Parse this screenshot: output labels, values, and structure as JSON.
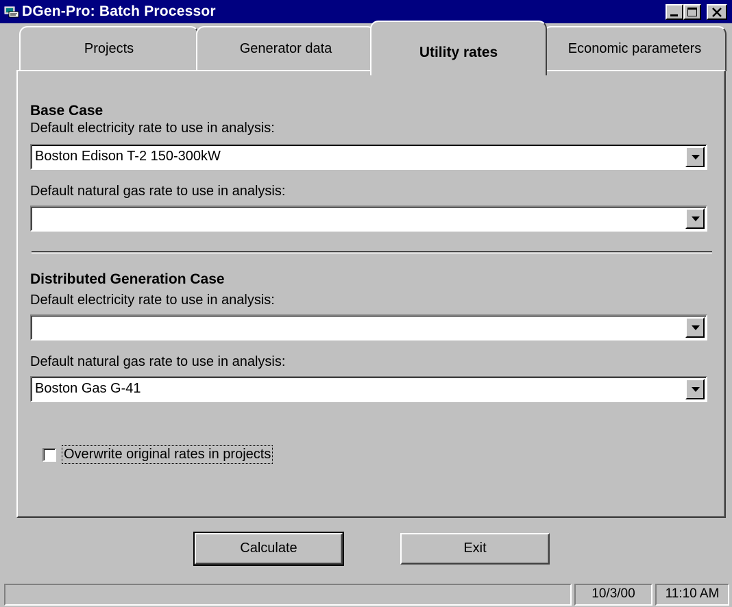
{
  "window": {
    "title": "DGen-Pro: Batch Processor"
  },
  "tabs": [
    {
      "label": "Projects",
      "active": false
    },
    {
      "label": "Generator data",
      "active": false
    },
    {
      "label": "Utility rates",
      "active": true
    },
    {
      "label": "Economic parameters",
      "active": false
    }
  ],
  "base_case": {
    "title": "Base Case",
    "electricity_label": "Default electricity rate to use in analysis:",
    "electricity_value": "Boston Edison T-2 150-300kW",
    "gas_label": "Default natural gas rate to use in analysis:",
    "gas_value": ""
  },
  "dg_case": {
    "title": "Distributed Generation Case",
    "electricity_label": "Default electricity rate to use in analysis:",
    "electricity_value": "",
    "gas_label": "Default natural gas rate to use in analysis:",
    "gas_value": "Boston Gas G-41"
  },
  "overwrite_checkbox": {
    "label": "Overwrite original rates in projects",
    "checked": false
  },
  "buttons": {
    "calculate": "Calculate",
    "exit": "Exit"
  },
  "status_bar": {
    "message": "",
    "date": "10/3/00",
    "time": "11:10 AM"
  },
  "icons": [
    "app-icon",
    "minimize-icon",
    "maximize-icon",
    "close-icon",
    "dropdown-arrow-icon"
  ],
  "colors": {
    "title_bar": "#000080",
    "face": "#c0c0c0"
  }
}
